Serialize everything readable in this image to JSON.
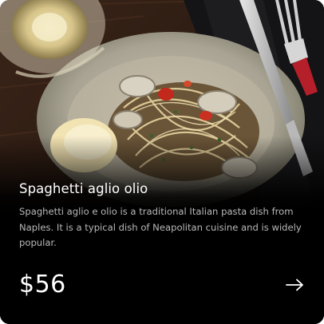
{
  "card": {
    "title": "Spaghetti aglio olio",
    "description": "Spaghetti aglio e olio is a traditional Italian pasta dish from Naples. It is a typical dish of Neapolitan cuisine and is widely popular.",
    "price": "$56",
    "action_icon": "arrow-right-icon"
  },
  "colors": {
    "background": "#000000",
    "text_primary": "#ffffff",
    "text_secondary": "#b8b8b8"
  }
}
